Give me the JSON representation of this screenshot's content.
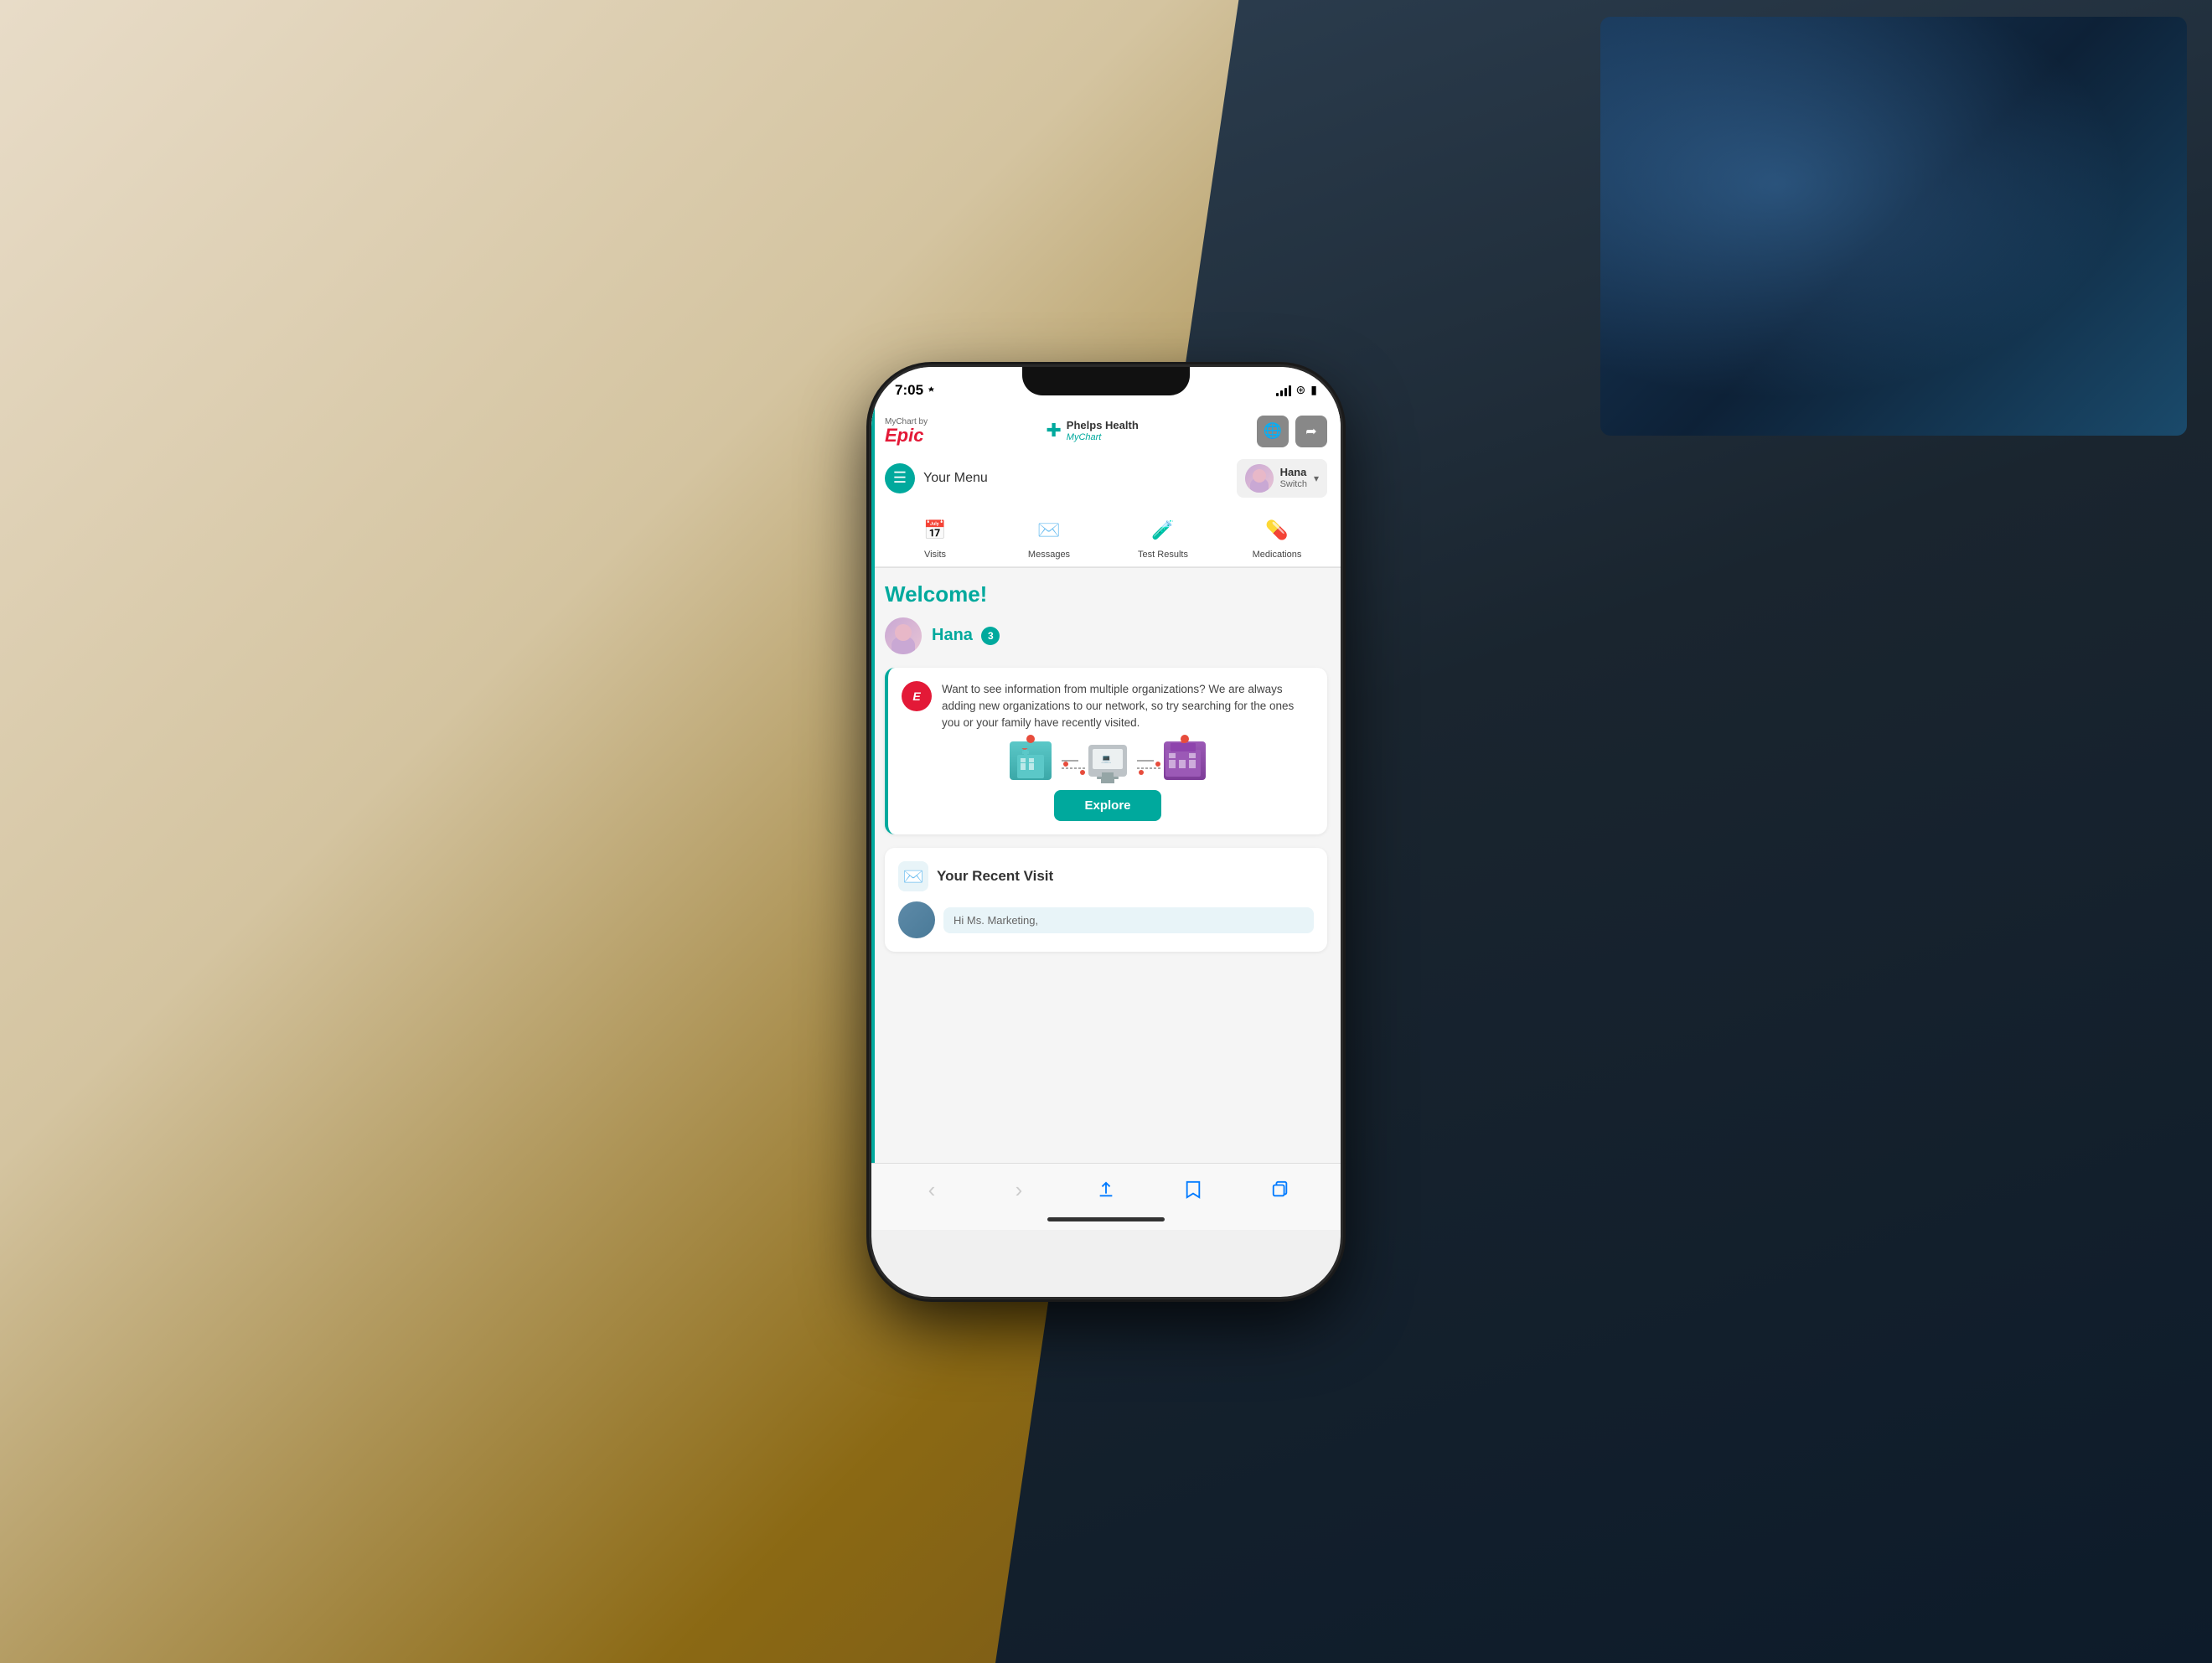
{
  "bg": {
    "description": "Hand holding phone over wooden desk with laptop in background"
  },
  "statusBar": {
    "time": "7:05",
    "signal": "signal",
    "wifi": "wifi",
    "battery": "battery"
  },
  "header": {
    "mychart_by": "MyChart by",
    "mychart_epic": "Epic",
    "phelps_health": "Phelps Health",
    "phelps_mychart": "MyChart",
    "globe_btn": "🌐",
    "signout_btn": "⬚",
    "menu_icon": "☰",
    "menu_label": "Your Menu",
    "user_name": "Hana",
    "user_switch": "Switch",
    "dropdown": "▾"
  },
  "quickNav": [
    {
      "icon": "📅",
      "label": "Visits"
    },
    {
      "icon": "✉️",
      "label": "Messages"
    },
    {
      "icon": "🧪",
      "label": "Test Results"
    },
    {
      "icon": "💊",
      "label": "Medications"
    }
  ],
  "main": {
    "welcome_title": "Welcome!",
    "user_name": "Hana",
    "notification_count": "3",
    "card_text": "Want to see information from multiple organizations? We are always adding new organizations to our network, so try searching for the ones you or your family have recently visited.",
    "explore_btn": "Explore",
    "recent_visit_title": "Your Recent Visit",
    "visit_preview": "Hi Ms. Marketing,"
  },
  "browserBar": {
    "back": "‹",
    "forward": "›",
    "share": "⬆",
    "bookmarks": "📖",
    "tabs": "⧉"
  }
}
